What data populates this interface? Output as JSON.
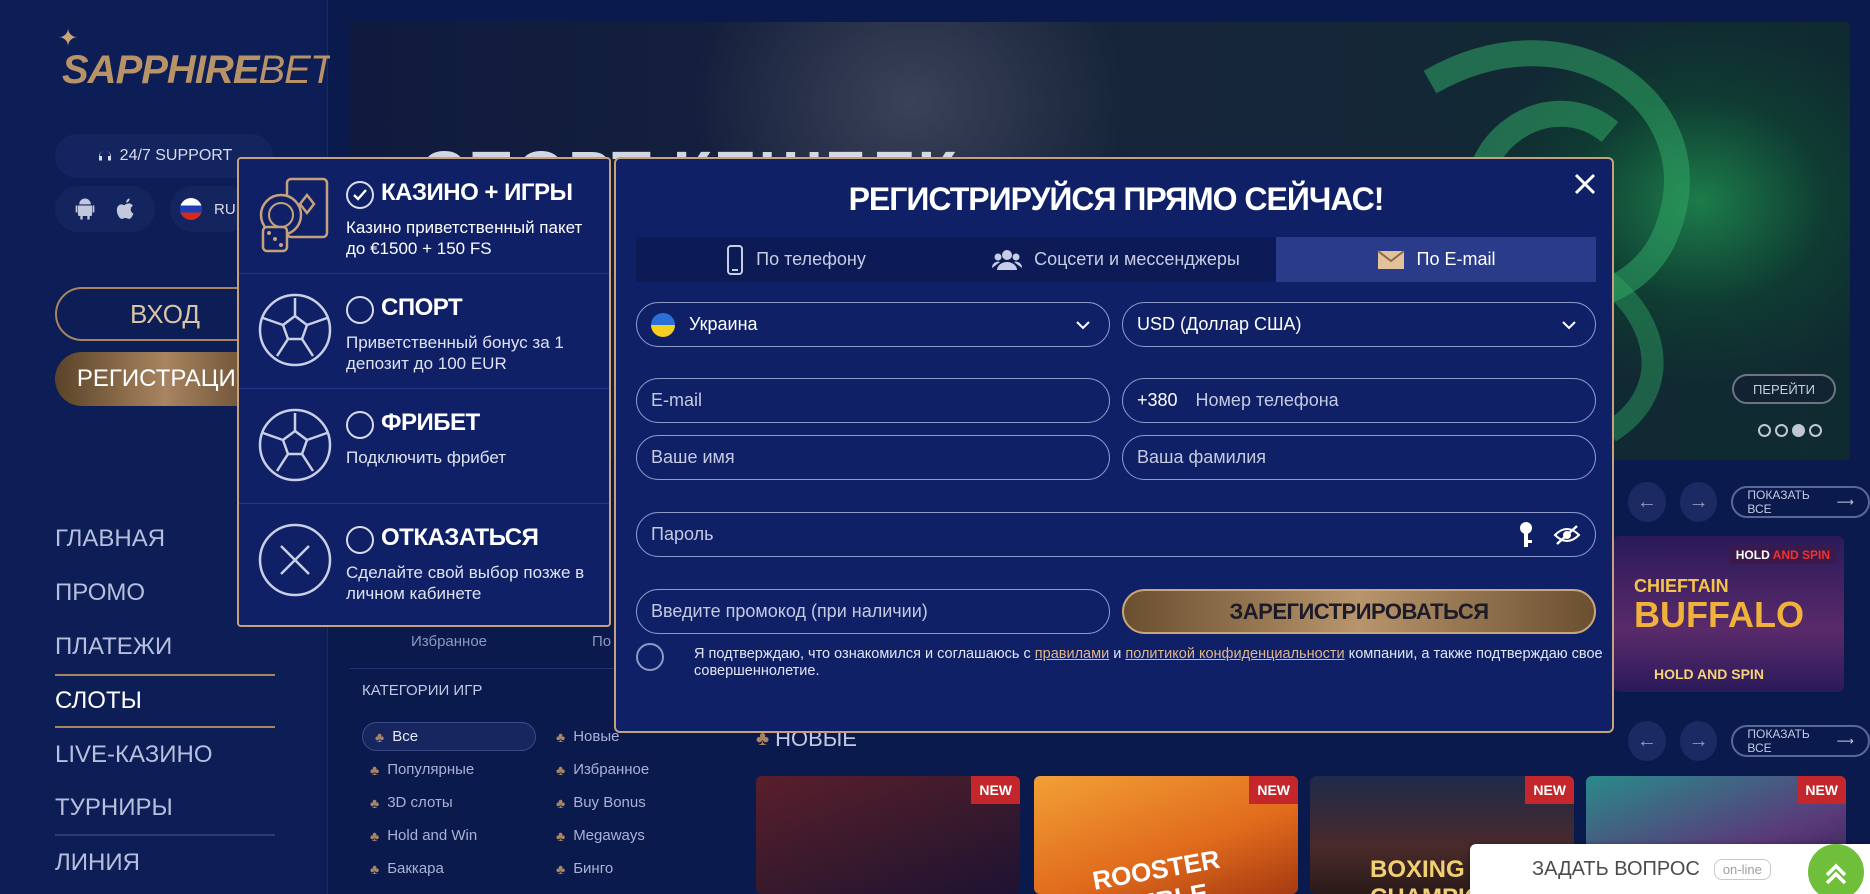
{
  "brand": {
    "name_main": "SAPPHIRE",
    "name_accent": "BET",
    "accent_color": "#b99368",
    "bg_color": "#0b1a4d"
  },
  "sidebar": {
    "support_label": "24/7 SUPPORT",
    "lang_code": "RU",
    "login_label": "ВХОД",
    "register_label": "РЕГИСТРАЦИЯ",
    "menu": [
      {
        "label": "ГЛАВНАЯ",
        "active": false
      },
      {
        "label": "ПРОМО",
        "active": false
      },
      {
        "label": "ПЛАТЕЖИ",
        "active": false
      },
      {
        "label": "СЛОТЫ",
        "active": true
      },
      {
        "label": "LIVE-КАЗИНО",
        "active": false
      },
      {
        "label": "ТУРНИРЫ",
        "active": false
      },
      {
        "label": "ЛИНИЯ",
        "active": false
      }
    ]
  },
  "banner": {
    "title": "СПОРТ КЕШБЕК",
    "go_label": "ПЕРЕЙТИ",
    "dots_total": 4,
    "dot_active": 3
  },
  "sections": {
    "show_all_label": "ПОКАЗАТЬ ВСЕ",
    "new_title": "НОВЫЕ",
    "new_badge": "NEW",
    "categories_title": "КАТЕГОРИИ ИГР",
    "fav_tab": "Избранное",
    "pop_tab": "По",
    "categories": [
      {
        "label": "Все",
        "selected": true
      },
      {
        "label": "Новые",
        "selected": false
      },
      {
        "label": "Популярные",
        "selected": false
      },
      {
        "label": "Избранное",
        "selected": false
      },
      {
        "label": "3D слоты",
        "selected": false
      },
      {
        "label": "Buy Bonus",
        "selected": false
      },
      {
        "label": "Hold and Win",
        "selected": false
      },
      {
        "label": "Megaways",
        "selected": false
      },
      {
        "label": "Баккара",
        "selected": false
      },
      {
        "label": "Бинго",
        "selected": false
      }
    ],
    "featured_game": {
      "line1": "HOLD",
      "line1_accent": "AND SPIN",
      "line2": "CHIEFTAIN",
      "line3": "BUFFALO",
      "line4": "HOLD AND SPIN"
    },
    "game_cards": [
      {
        "name": ""
      },
      {
        "name": "ROOSTER RUMBLE"
      },
      {
        "name": "BOXING CHAMPION"
      },
      {
        "name": ""
      }
    ]
  },
  "bonus": {
    "items": [
      {
        "title": "КАЗИНО + ИГРЫ",
        "desc": "Казино приветственный пакет до €1500 + 150 FS",
        "checked": true,
        "icon": "cards-dice-icon"
      },
      {
        "title": "СПОРТ",
        "desc": "Приветственный бонус за 1 депозит до 100 EUR",
        "checked": false,
        "icon": "soccer-ball-icon"
      },
      {
        "title": "ФРИБЕТ",
        "desc": "Подключить фрибет",
        "checked": false,
        "icon": "soccer-ball-icon"
      },
      {
        "title": "ОТКАЗАТЬСЯ",
        "desc": "Сделайте свой выбор позже в личном кабинете",
        "checked": false,
        "icon": "close-circle-icon"
      }
    ]
  },
  "modal": {
    "title": "РЕГИСТРИРУЙСЯ ПРЯМО СЕЙЧАС!",
    "tabs": [
      {
        "label": "По телефону",
        "icon": "phone-icon",
        "active": false
      },
      {
        "label": "Соцсети и мессенджеры",
        "icon": "users-icon",
        "active": false
      },
      {
        "label": "По E-mail",
        "icon": "envelope-icon",
        "active": true
      }
    ],
    "country": "Украина",
    "currency": "USD (Доллар США)",
    "email_placeholder": "E-mail",
    "phone_prefix": "+380",
    "phone_placeholder": "Номер телефона",
    "first_name_placeholder": "Ваше имя",
    "last_name_placeholder": "Ваша фамилия",
    "password_placeholder": "Пароль",
    "promo_placeholder": "Введите промокод (при наличии)",
    "submit_label": "ЗАРЕГИСТРИРОВАТЬСЯ",
    "agree_pre": "Я подтверждаю, что ознакомился и соглашаюсь с ",
    "agree_link1": "правилами",
    "agree_mid": " и ",
    "agree_link2": "политикой конфиденциальности",
    "agree_post": " компании, а также подтверждаю свое совершеннолетие."
  },
  "chat": {
    "title": "ЗАДАТЬ ВОПРОС",
    "status": "on-line"
  }
}
